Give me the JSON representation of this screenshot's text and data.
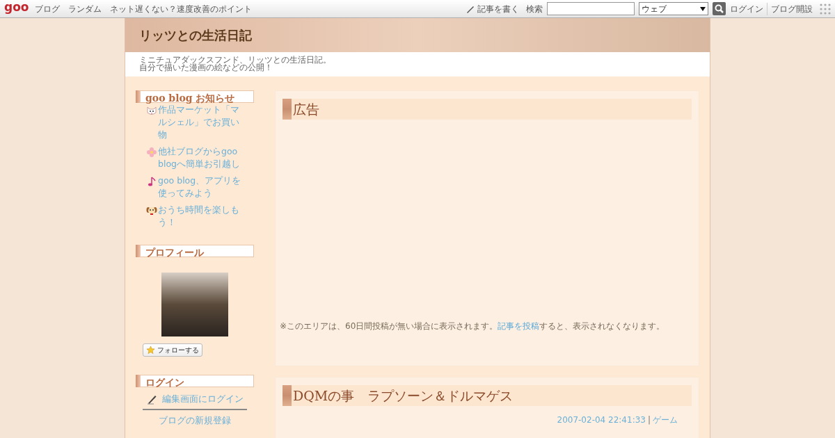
{
  "topbar": {
    "logo": "goo",
    "links": [
      "ブログ",
      "ランダム",
      "ネット遅くない？速度改善のポイント"
    ],
    "write": "記事を書く",
    "search_label": "検索",
    "search_scope": "ウェブ",
    "login": "ログイン",
    "signup": "ブログ開設"
  },
  "header": {
    "title": "リッツとの生活日記",
    "description": [
      "ミニチュアダックスフンド、リッツとの生活日記。",
      "自分で描いた漫画の絵などの公開！"
    ]
  },
  "sidebar": {
    "news": {
      "title": "goo blog お知らせ",
      "items": [
        {
          "kind": "cat",
          "text": "作品マーケット「マルシェル」でお買い物"
        },
        {
          "kind": "flower",
          "text": "他社ブログからgoo blogへ簡単お引越し"
        },
        {
          "kind": "note",
          "text": "goo blog、アプリを使ってみよう"
        },
        {
          "kind": "dog",
          "text": "おうち時間を楽しもう！"
        }
      ]
    },
    "profile": {
      "title": "プロフィール",
      "follow": "フォローする"
    },
    "login": {
      "title": "ログイン",
      "edit_login": "編集画面にログイン",
      "register": "ブログの新規登録"
    }
  },
  "ad": {
    "title": "広告",
    "notice": {
      "before": "※このエリアは、60日間投稿が無い場合に表示されます。",
      "link": "記事を投稿",
      "after": "すると、表示されなくなります。"
    }
  },
  "post": {
    "title": "DQMの事　ラプソーン＆ドルマゲス",
    "datetime": "2007-02-04 22:41:33",
    "separator": "|",
    "category": "ゲーム"
  }
}
